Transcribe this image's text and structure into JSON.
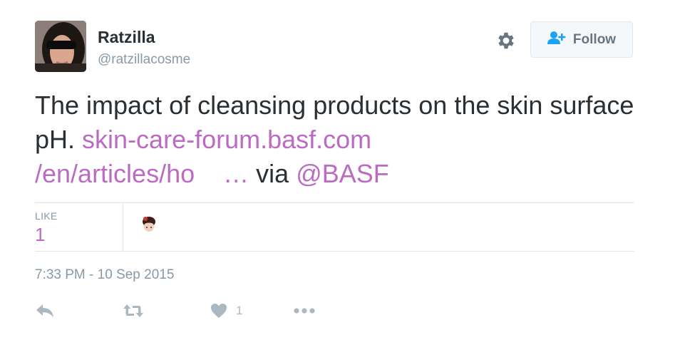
{
  "user": {
    "display_name": "Ratzilla",
    "screen_name": "@ratzillacosme"
  },
  "follow_button": {
    "label": "Follow"
  },
  "tweet": {
    "text_part1": "The impact of cleansing products on the skin surface pH.",
    "link_part1": "skin-care-forum.basf.com",
    "link_part2": "/en/articles/ho",
    "link_ellipsis": "…",
    "via_text": "via",
    "mention": "@BASF"
  },
  "stats": {
    "like_label": "LIKE",
    "like_count": "1"
  },
  "timestamp": "7:33 PM - 10 Sep 2015",
  "actions": {
    "like_count": "1"
  },
  "colors": {
    "link": "#bb6cc2",
    "muted": "#8899a6",
    "text": "#292f33",
    "action_icon": "#aab8c2"
  },
  "icons": {
    "settings": "gear-icon",
    "follow": "follow-person-plus-icon",
    "reply": "reply-icon",
    "retweet": "retweet-icon",
    "like": "heart-icon",
    "more": "more-dots-icon"
  }
}
